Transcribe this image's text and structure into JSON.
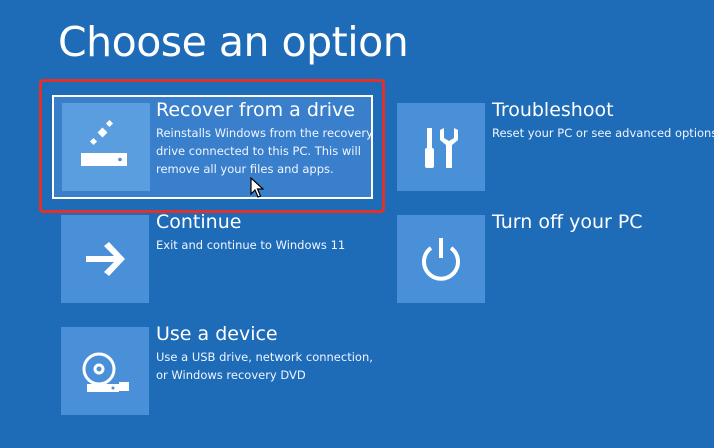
{
  "title": "Choose an option",
  "options": [
    {
      "label": "Recover from a drive",
      "description": "Reinstalls Windows from the recovery drive connected to this PC. This will remove all your files and apps.",
      "icon": "recovery-drive-icon",
      "selected": true
    },
    {
      "label": "Troubleshoot",
      "description": "Reset your PC or see advanced options",
      "icon": "tools-icon"
    },
    {
      "label": "Continue",
      "description": "Exit and continue to Windows 11",
      "icon": "arrow-right-icon"
    },
    {
      "label": "Turn off your PC",
      "description": "",
      "icon": "power-icon"
    },
    {
      "label": "Use a device",
      "description": "Use a USB drive, network connection, or Windows recovery DVD",
      "icon": "disc-drive-icon"
    }
  ],
  "colors": {
    "background": "#1e6bb8",
    "tile": "#4a90d9",
    "selected_background": "#3a7fcc",
    "highlight_border": "#e0312a"
  }
}
